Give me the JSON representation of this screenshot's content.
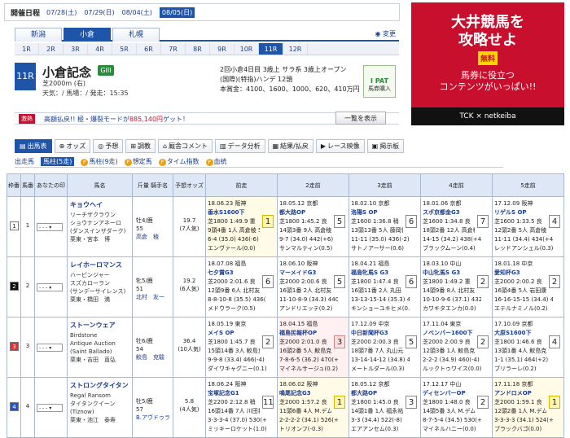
{
  "date_bar": {
    "label": "開催日程",
    "dates": [
      "07/28(土)",
      "07/29(日)",
      "08/04(土)",
      "08/05(日)"
    ],
    "active": 3
  },
  "venues": {
    "tabs": [
      "新潟",
      "小倉",
      "札幌"
    ],
    "active": 1,
    "henko": "変更"
  },
  "race_tabs": {
    "items": [
      "1R",
      "2R",
      "3R",
      "4R",
      "5R",
      "6R",
      "7R",
      "8R",
      "9R",
      "10R",
      "11R",
      "12R"
    ],
    "active": 10
  },
  "race": {
    "num": "11R",
    "name": "小倉記念",
    "grade": "GIII",
    "course": "芝2000m (右)",
    "weather": "天気：/ 馬場：/ 発走：15:35",
    "cond1": "2回小倉4日目 3歳上 サラ系 3歳上オープン",
    "cond2": "(国際)(特指)ハンデ 12頭",
    "cond3": "本賞金：4100、1600、1000、620、410万円"
  },
  "ipat": {
    "l1": "I PAT",
    "l2": "馬券購入"
  },
  "ad": {
    "l1": "大井競馬を",
    "l2": "攻略せよ",
    "badge": "無料",
    "l3": "馬券に役立つ",
    "l4": "コンテンツがいっぱい!!",
    "l5": "TCK × netkeiba"
  },
  "dividend": {
    "badge": "激熱",
    "text": "高額払戻!! 極・爆裂モードが",
    "amount": "885,140円",
    "text2": "ゲット！",
    "btn": "一覧を表示"
  },
  "main_nav": [
    {
      "icon": "▤",
      "label": "出馬表"
    },
    {
      "icon": "⊕",
      "label": "オッズ"
    },
    {
      "icon": "◎",
      "label": "予想"
    },
    {
      "icon": "⊞",
      "label": "調教"
    },
    {
      "icon": "⌂",
      "label": "厩舎コメント"
    },
    {
      "icon": "▥",
      "label": "データ分析"
    },
    {
      "icon": "▦",
      "label": "結果/払戻"
    },
    {
      "icon": "▶",
      "label": "レース映像"
    },
    {
      "icon": "▣",
      "label": "掲示板"
    }
  ],
  "sub_nav": [
    {
      "label": "出走馬",
      "p": false
    },
    {
      "label": "馬柱(5走)",
      "p": false
    },
    {
      "label": "馬柱(9走)",
      "p": true
    },
    {
      "label": "想定馬",
      "p": true
    },
    {
      "label": "タイム指数",
      "p": true
    },
    {
      "label": "血統",
      "p": true
    }
  ],
  "headers": [
    "枠番",
    "馬番",
    "あなたの印",
    "馬名",
    "斤量 騎手名",
    "予想オッズ",
    "前走",
    "2走前",
    "3走前",
    "4走前",
    "5走前"
  ],
  "mark_option": "- - -",
  "horses": [
    {
      "waku": "1",
      "ban": "1",
      "waku_bg": "#ffffff",
      "waku_fg": "#222",
      "name": "キョウヘイ",
      "sire": "リーチザクラウン",
      "dam": "ショウナンアネーロ",
      "damsire": "(ダンスインザダーク)",
      "stable": "栗東・宮本　博",
      "sex": "牡4/鹿",
      "kin": "55",
      "jockey": "高倉　稜",
      "odds": "19.7",
      "ninki": "(7人気)",
      "past": [
        {
          "d": "18.06.23 阪神",
          "r": "垂水S1600下",
          "t": "芝1800 1:49.9 重",
          "p": "9頭4番 1人 高倉稜 57.0",
          "c": "6-4 (35.0) 436(-6)",
          "w": "エンヴァール(0.0)",
          "rk": "1",
          "k": "y"
        },
        {
          "d": "18.05.12 京都",
          "r": "都大路OP",
          "t": "芝1800 1:45.2 良",
          "p": "14頭3番 9人 高倉稜 56.0",
          "c": "9-7 (34.0) 442(+6)",
          "w": "サンマルティン(0.5)",
          "rk": "5",
          "k": ""
        },
        {
          "d": "18.02.10 京都",
          "r": "洛陽S OP",
          "t": "芝1600 1:36.8 稍",
          "p": "13頭13番 5人 藤岡佑 56.0",
          "c": "11-11 (35.0) 436(-2)",
          "w": "サトノアーサー(0.6)",
          "rk": "6",
          "k": ""
        },
        {
          "d": "18.01.06 京都",
          "r": "スポ京都金G3",
          "t": "芝1600 1:34.8 良",
          "p": "18頭2番 12人 高倉稜 53.0",
          "c": "14-15 (34.2) 438(+4)",
          "w": "ブラックムーン(0.4)",
          "rk": "7",
          "k": ""
        },
        {
          "d": "17.12.09 阪神",
          "r": "リゲルS OP",
          "t": "芝1600 1:33.5 良",
          "p": "12頭2番 5人 高倉稜 55.0",
          "c": "11-11 (34.4) 434(+4)",
          "w": "レッドアンシェル(0.3)",
          "rk": "4",
          "k": ""
        }
      ]
    },
    {
      "waku": "2",
      "ban": "2",
      "waku_bg": "#111111",
      "waku_fg": "#fff",
      "name": "レイホーロマンス",
      "sire": "ハービンジャー",
      "dam": "スズカローラン",
      "damsire": "(サンデーサイレンス)",
      "stable": "栗東・橋田　満",
      "sex": "牝5/鹿",
      "kin": "51",
      "jockey": "北村　友一",
      "odds": "19.2",
      "ninki": "(6人気)",
      "past": [
        {
          "d": "18.07.08 福島",
          "r": "七夕賞G3",
          "t": "芝2000 2:01.6 良",
          "p": "12頭9番 6人 北村友 51.0",
          "c": "8-8-10-8 (35.5) 436(-4)",
          "w": "メドウラーク(0.5)",
          "rk": "6",
          "k": ""
        },
        {
          "d": "18.06.10 阪神",
          "r": "マーメイドG3",
          "t": "芝2000 2:00.6 良",
          "p": "16頭1番 2人 北村友 53.0",
          "c": "11-10-8-9 (34.3) 440(+2)",
          "w": "アンドリエッテ(0.2)",
          "rk": "5",
          "k": ""
        },
        {
          "d": "18.04.21 福島",
          "r": "福島牝馬S G3",
          "t": "芝1800 1:47.4 良",
          "p": "16頭11番 2人 丸田 53.0",
          "c": "13-13-15-14 (35.3) 438(+6)",
          "w": "キンショーユキヒメ(0.4)",
          "rk": "6",
          "k": ""
        },
        {
          "d": "18.03.10 中山",
          "r": "中山牝馬S G3",
          "t": "芝1800 1:49.2 重",
          "p": "14頭9番 8人 北村友 52.0",
          "c": "10-10-9-6 (37.1) 432(-6)",
          "w": "カワキタエンカ(0.0)",
          "rk": "2",
          "k": ""
        },
        {
          "d": "18.01.18 中京",
          "r": "愛知杯G3",
          "t": "芝2000 2:00.2 良",
          "p": "16頭4番 5人 岩田康 51.0",
          "c": "16-16-15-15 (34.4) 438(+2)",
          "w": "エテルナミノル(0.2)",
          "rk": "2",
          "k": ""
        }
      ]
    },
    {
      "waku": "3",
      "ban": "3",
      "waku_bg": "#e03030",
      "waku_fg": "#fff",
      "name": "ストーンウェア",
      "sire": "Birdstone",
      "dam": "Antique Auction",
      "damsire": "(Saint Ballado)",
      "stable": "栗東・吉田　直弘",
      "sex": "牡6/鹿",
      "kin": "54",
      "jockey": "鮫島　克駿",
      "odds": "36.4",
      "ninki": "(10人気)",
      "past": [
        {
          "d": "18.05.19 東京",
          "r": "メイS OP",
          "t": "芝1800 1:45.7 良",
          "p": "15頭14番 3人 鮫島克 54.0",
          "c": "9-9-8 (33.4) 466(-4)",
          "w": "ダイワキャグニー(0.1)",
          "rk": "2",
          "k": ""
        },
        {
          "d": "18.04.15 福島",
          "r": "福島民報杯OP",
          "t": "芝2000 2:01.0 良",
          "p": "16頭2番 5人 鮫島克 56.0",
          "c": "7-8-6-5 (36.2) 470(+8)",
          "w": "マイネルサージュ(0.2)",
          "rk": "3",
          "k": "p"
        },
        {
          "d": "17.12.09 中京",
          "r": "中日新聞杯G3",
          "t": "芝2000 2:00.3 良",
          "p": "18頭7番 7人 丸山元 54.0",
          "c": "13-14-14-12 (34.8) 462(+2)",
          "w": "メートルダール(0.3)",
          "rk": "5",
          "k": ""
        },
        {
          "d": "17.11.04 東京",
          "r": "ノベンバー1600下",
          "t": "芝2000 2:00.9 良",
          "p": "12頭3番 1人 鮫島克 57.0",
          "c": "2-2-2 (34.9) 460(-4)",
          "w": "ルックトゥワイス(0.0)",
          "rk": "2",
          "k": ""
        },
        {
          "d": "17.10.09 京都",
          "r": "大原S1600下",
          "t": "芝1800 1:46.6 良",
          "p": "13頭1番 4人 鮫島克 56.0",
          "c": "1-1 (35.1) 464(+2)",
          "w": "ブリラーレ(0.2)",
          "rk": "4",
          "k": ""
        }
      ]
    },
    {
      "waku": "4",
      "ban": "4",
      "waku_bg": "#1f55c8",
      "waku_fg": "#fff",
      "name": "ストロングタイタン",
      "sire": "Regal Ransom",
      "dam": "タイタンクイーン",
      "damsire": "(Tiznow)",
      "stable": "栗東・池江　泰寿",
      "sex": "牡5/鹿",
      "kin": "57",
      "jockey": "B.アヴドゥラ",
      "odds": "5.8",
      "ninki": "(4人気)",
      "past": [
        {
          "d": "18.06.24 阪神",
          "r": "宝塚記念G1",
          "t": "芝2200 2:12.8 稍",
          "p": "16頭14番 7人 川田将 58.0",
          "c": "3-3-3-4 (37.0) 530(+4)",
          "w": "ミッキーロケット(1.0)",
          "rk": "11",
          "k": ""
        },
        {
          "d": "18.06.02 阪神",
          "r": "鳴尾記念G3",
          "t": "芝2000 1:57.2 良",
          "p": "11頭6番 4人 M.デム 56.0",
          "c": "2-2-2-2 (34.1) 526(+4)",
          "w": "トリオンフ(-0.3)",
          "rk": "1",
          "k": "y"
        },
        {
          "d": "18.05.12 京都",
          "r": "都大路OP",
          "t": "芝1800 1:45.0 良",
          "p": "14頭1番 1人 福永祐 56.0",
          "c": "3-3 (34.4) 522(-8)",
          "w": "エアアンセム(0.3)",
          "rk": "3",
          "k": ""
        },
        {
          "d": "17.12.17 中山",
          "r": "ディセンバーOP",
          "t": "芝1800 1:48.0 良",
          "p": "14頭5番 3人 M.デム 56.0",
          "c": "8-7-5-4 (34.5) 530(+6)",
          "w": "マイネルハニー(0.0)",
          "rk": "2",
          "k": ""
        },
        {
          "d": "17.11.18 京都",
          "r": "アンドロメOP",
          "t": "芝2000 1:59.1 良",
          "p": "12頭2番 1人 M.デム 56.0",
          "c": "3-3-3-3 (34.1) 524(+2)",
          "w": "ブラックバゴ(0.0)",
          "rk": "1",
          "k": "y"
        }
      ]
    }
  ]
}
